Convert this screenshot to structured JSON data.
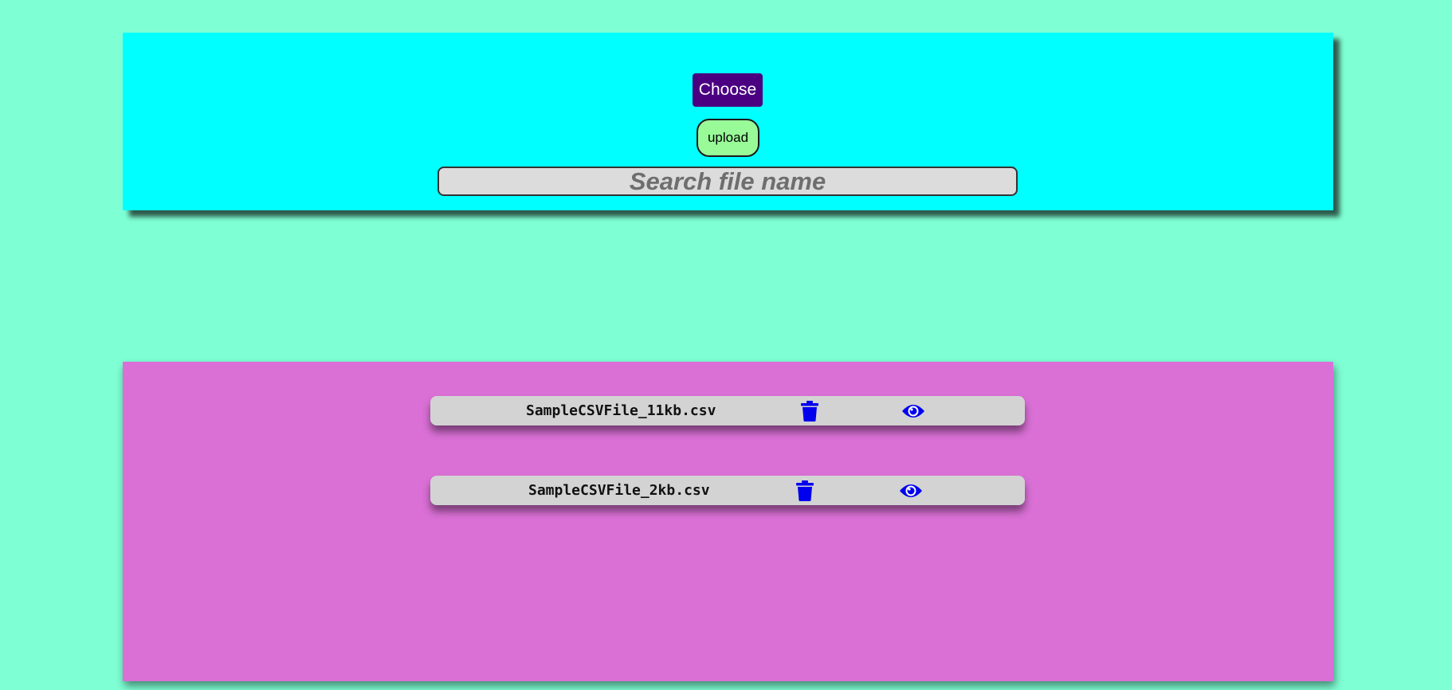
{
  "upload": {
    "choose_label": "Choose",
    "upload_label": "upload",
    "search_placeholder": "Search file name"
  },
  "files": [
    {
      "name": "SampleCSVFile_11kb.csv",
      "delete_icon": "trash-icon",
      "view_icon": "eye-icon"
    },
    {
      "name": "SampleCSVFile_2kb.csv",
      "delete_icon": "trash-icon",
      "view_icon": "eye-icon"
    }
  ],
  "colors": {
    "page_background": "#7fffd4",
    "upload_panel": "#00ffff",
    "files_panel": "#da70d6",
    "choose_button": "#4b0082",
    "upload_button": "#98fb98",
    "file_row": "#d3d3d3",
    "icon": "#0000ee"
  }
}
